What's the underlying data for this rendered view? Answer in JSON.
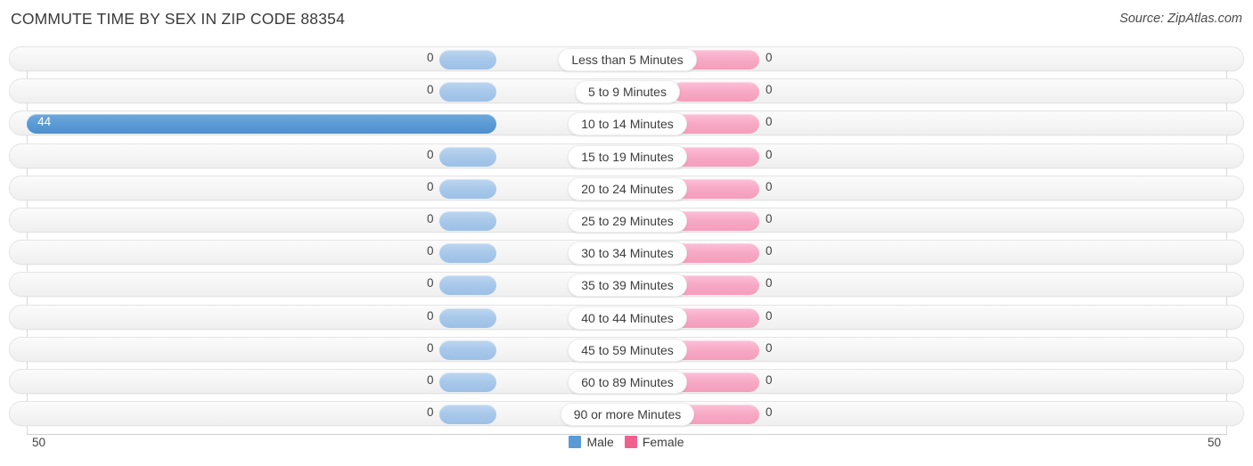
{
  "header": {
    "title": "COMMUTE TIME BY SEX IN ZIP CODE 88354",
    "source": "Source: ZipAtlas.com"
  },
  "legend": {
    "male": {
      "label": "Male",
      "color": "#5b9bd5"
    },
    "female": {
      "label": "Female",
      "color": "#f0608f"
    }
  },
  "axis": {
    "left_label": "50",
    "right_label": "50",
    "max": 50
  },
  "colors": {
    "male_zero": "#a8c8ea",
    "male_value": "#5b9bd5",
    "female_zero": "#f7a9c4",
    "female_value": "#f0608f",
    "row_track": "#f5f5f5",
    "gridline": "#d9d9d9"
  },
  "chart_data": {
    "type": "bar",
    "title": "COMMUTE TIME BY SEX IN ZIP CODE 88354",
    "subtitle": "Source: ZipAtlas.com",
    "orientation": "horizontal-diverging",
    "xlabel": "",
    "ylabel": "",
    "xlim": [
      50,
      50
    ],
    "grid": true,
    "legend_position": "bottom-center",
    "categories": [
      "Less than 5 Minutes",
      "5 to 9 Minutes",
      "10 to 14 Minutes",
      "15 to 19 Minutes",
      "20 to 24 Minutes",
      "25 to 29 Minutes",
      "30 to 34 Minutes",
      "35 to 39 Minutes",
      "40 to 44 Minutes",
      "45 to 59 Minutes",
      "60 to 89 Minutes",
      "90 or more Minutes"
    ],
    "series": [
      {
        "name": "Male",
        "side": "left",
        "values": [
          0,
          0,
          44,
          0,
          0,
          0,
          0,
          0,
          0,
          0,
          0,
          0
        ],
        "labels": [
          "0",
          "0",
          "44",
          "0",
          "0",
          "0",
          "0",
          "0",
          "0",
          "0",
          "0",
          "0"
        ]
      },
      {
        "name": "Female",
        "side": "right",
        "values": [
          0,
          0,
          0,
          0,
          0,
          0,
          0,
          0,
          0,
          0,
          0,
          0
        ],
        "labels": [
          "0",
          "0",
          "0",
          "0",
          "0",
          "0",
          "0",
          "0",
          "0",
          "0",
          "0",
          "0"
        ]
      }
    ]
  }
}
